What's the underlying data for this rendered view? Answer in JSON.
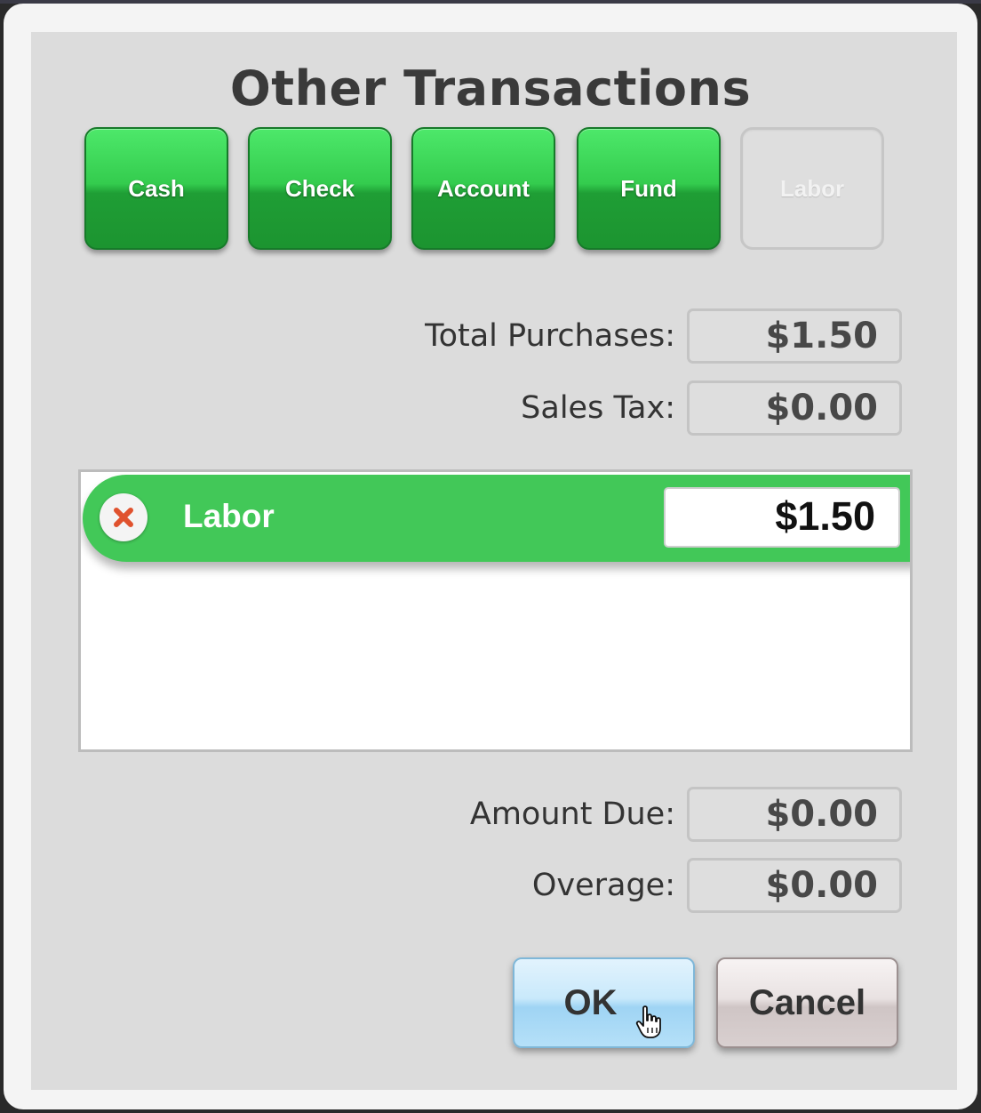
{
  "dialog": {
    "title": "Other Transactions",
    "tender_buttons": [
      {
        "label": "Cash",
        "state": "active"
      },
      {
        "label": "Check",
        "state": "active"
      },
      {
        "label": "Account",
        "state": "active"
      },
      {
        "label": "Fund",
        "state": "active"
      },
      {
        "label": "Labor",
        "state": "disabled"
      }
    ],
    "summary": {
      "total_purchases_label": "Total Purchases:",
      "total_purchases_value": "$1.50",
      "sales_tax_label": "Sales Tax:",
      "sales_tax_value": "$0.00"
    },
    "transactions": [
      {
        "label": "Labor",
        "amount": "$1.50",
        "remove_icon": "close-x-icon"
      }
    ],
    "totals": {
      "amount_due_label": "Amount Due:",
      "amount_due_value": "$0.00",
      "overage_label": "Overage:",
      "overage_value": "$0.00"
    },
    "actions": {
      "ok_label": "OK",
      "cancel_label": "Cancel"
    }
  },
  "colors": {
    "accent_green": "#42c858",
    "button_green": "#34cc4e",
    "ok_blue": "#b5e0f8",
    "remove_red": "#e0522e"
  }
}
